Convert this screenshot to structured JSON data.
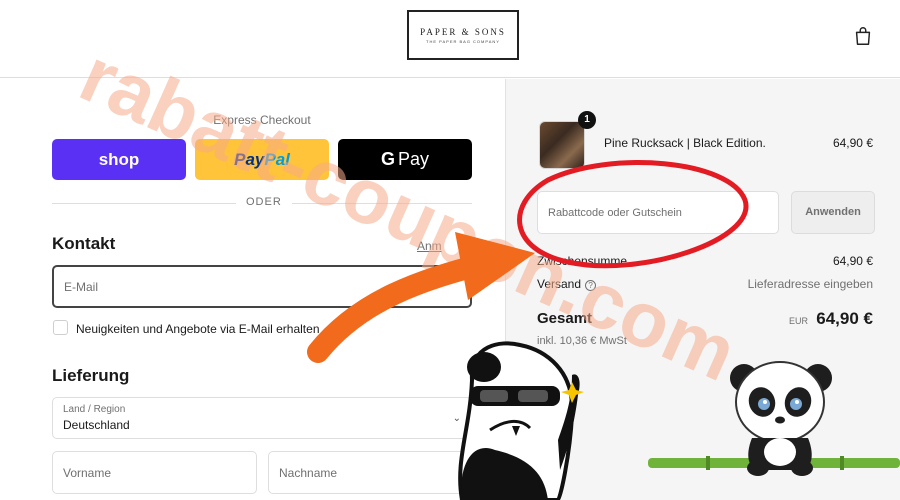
{
  "header": {
    "logo_main": "PAPER & SONS",
    "logo_sub": "THE PAPER BAG COMPANY",
    "cart_icon": "shopping-bag-icon"
  },
  "express": {
    "title": "Express Checkout",
    "shop_label": "shop",
    "paypal_label_1": "Pay",
    "paypal_label_2": "Pal",
    "gpay_g": "G",
    "gpay_label": "Pay",
    "divider_label": "ODER"
  },
  "contact": {
    "heading": "Kontakt",
    "login_link": "Anm",
    "email_placeholder": "E-Mail",
    "newsletter_label": "Neuigkeiten und Angebote via E-Mail erhalten"
  },
  "delivery": {
    "heading": "Lieferung",
    "country_label": "Land / Region",
    "country_value": "Deutschland",
    "first_name_placeholder": "Vorname",
    "last_name_placeholder": "Nachname"
  },
  "summary": {
    "quantity": "1",
    "product_name": "Pine Rucksack | Black Edition.",
    "product_price": "64,90 €",
    "discount_placeholder": "Rabattcode oder Gutschein",
    "apply_label": "Anwenden",
    "subtotal_label": "Zwischensumme",
    "subtotal_value": "64,90 €",
    "shipping_label": "Versand",
    "shipping_value": "Lieferadresse eingeben",
    "total_label": "Gesamt",
    "total_currency": "EUR",
    "total_value": "64,90 €",
    "tax_note": "inkl. 10,36 € MwSt"
  },
  "overlay": {
    "watermark_text": "rabatt-coupon.com",
    "highlight_color": "#e31b23",
    "arrow_color": "#f26a1b",
    "watermark_color": "#f5a98a"
  }
}
